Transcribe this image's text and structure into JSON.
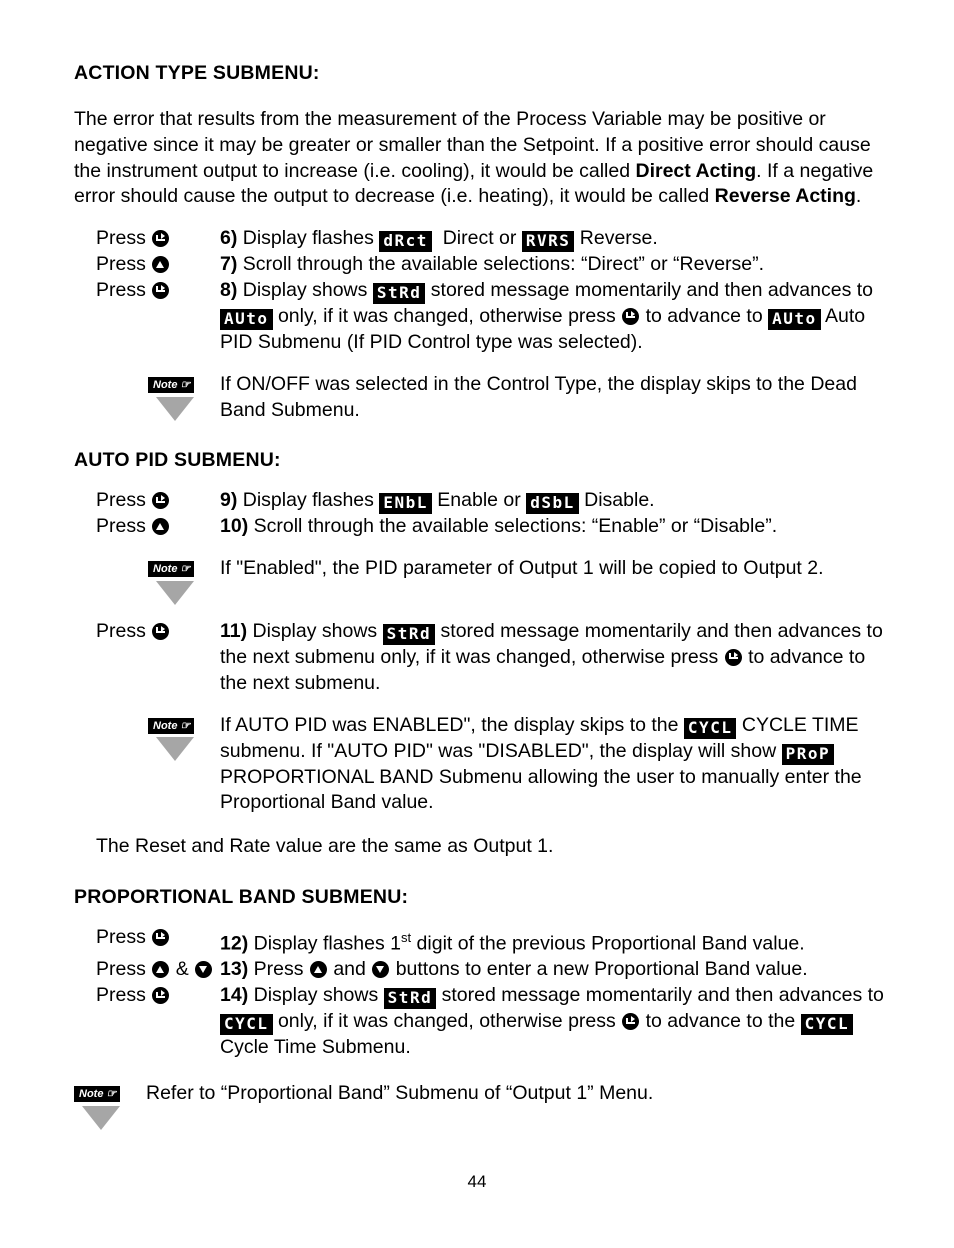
{
  "page": {
    "number": "44"
  },
  "sections": {
    "action_type": {
      "heading": "ACTION TYPE SUBMENU:",
      "paragraph_part1": "The error that results from the measurement of the Process Variable may be positive or negative since it may be greater or smaller than the Setpoint. If a positive error should cause the instrument output to increase (i.e. cooling), it would be called ",
      "paragraph_bold1": "Direct Acting",
      "paragraph_part2": ". If a negative error should cause the output to decrease (i.e. heating), it would be called ",
      "paragraph_bold2": "Reverse Acting",
      "paragraph_part3": ".",
      "steps": [
        {
          "press_label": "Press",
          "press_buttons": [
            "enter"
          ],
          "number": "6)",
          "text_a": "Display flashes",
          "led1": "dRct",
          "text_b": "Direct or",
          "led2": "RVRS",
          "text_c": "Reverse."
        },
        {
          "press_label": "Press",
          "press_buttons": [
            "up"
          ],
          "number": "7)",
          "text_a": "Scroll through the available selections: “Direct” or “Reverse”."
        },
        {
          "press_label": "Press",
          "press_buttons": [
            "enter"
          ],
          "number": "8)",
          "text_a": "Display shows",
          "led1": "StRd",
          "text_b": "stored message momentarily and then advances to",
          "led2": "AUto",
          "text_c": "only, if it was changed, otherwise press",
          "text_d": "to advance to",
          "led3": "AUto",
          "text_e": "Auto PID Submenu (If PID Control type was selected)."
        }
      ],
      "note": {
        "tag": "Note",
        "text": "If ON/OFF was selected in the Control Type, the display skips to the Dead Band Submenu."
      }
    },
    "auto_pid": {
      "heading": "AUTO PID SUBMENU:",
      "steps": [
        {
          "press_label": "Press",
          "press_buttons": [
            "enter"
          ],
          "number": "9)",
          "text_a": "Display flashes",
          "led1": "ENbL",
          "text_b": "Enable or",
          "led2": "dSbL",
          "text_c": "Disable."
        },
        {
          "press_label": "Press",
          "press_buttons": [
            "up"
          ],
          "number": "10)",
          "text_a": "Scroll through the available selections: “Enable” or “Disable”."
        }
      ],
      "note1": {
        "tag": "Note",
        "text": "If \"Enabled\", the PID parameter of Output 1 will be copied to Output 2."
      },
      "step11": {
        "press_label": "Press",
        "press_buttons": [
          "enter"
        ],
        "number": "11)",
        "text_a": "Display shows",
        "led1": "StRd",
        "text_b": "stored message momentarily and then advances to the next submenu only, if it was changed, otherwise press",
        "text_c": "to advance to the next submenu."
      },
      "note2": {
        "tag": "Note",
        "text_a": "If AUTO PID  was  ENABLED\", the display skips to the",
        "led1": "CYCL",
        "text_b": "CYCLE TIME submenu. If \"AUTO PID\" was \"DISABLED\", the display will show",
        "led2": "PRoP",
        "text_c": "PROPORTIONAL BAND Submenu allowing the user to manually enter the Proportional Band value."
      },
      "closing_line": "The Reset and Rate value are the same as Output 1."
    },
    "proportional_band": {
      "heading": "PROPORTIONAL BAND SUBMENU:",
      "steps": [
        {
          "press_label": "Press",
          "press_buttons": [
            "enter"
          ],
          "number": "12)",
          "text_a": "Display flashes 1",
          "ordinal": "st",
          "text_b": " digit of the previous Proportional Band value."
        },
        {
          "press_label": "Press",
          "press_buttons": [
            "up",
            "down"
          ],
          "press_joiner": "&",
          "number": "13)",
          "text_a": "Press",
          "text_b": "and",
          "text_c": "buttons to enter a new Proportional Band value."
        },
        {
          "press_label": "Press",
          "press_buttons": [
            "enter"
          ],
          "number": "14)",
          "text_a": "Display shows",
          "led1": "StRd",
          "text_b": "stored message momentarily and then advances to",
          "led2": "CYCL",
          "text_c": "only, if it was changed, otherwise press",
          "text_d": "to advance to the",
          "led3": "CYCL",
          "text_e": "Cycle Time Submenu."
        }
      ],
      "final_note": {
        "tag": "Note",
        "text": "Refer to “Proportional Band” Submenu of “Output 1” Menu."
      }
    }
  }
}
